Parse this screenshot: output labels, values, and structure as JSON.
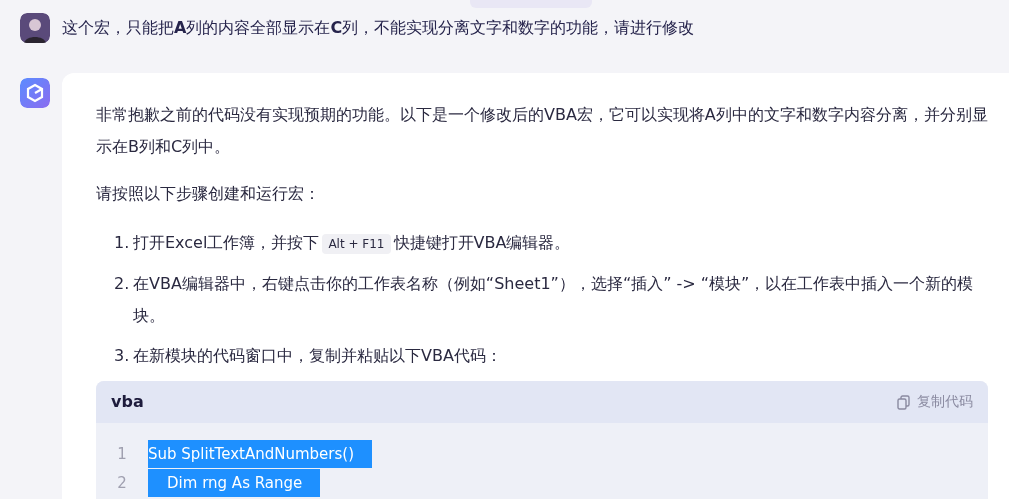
{
  "user_message": {
    "text": "这个宏，只能把**A**列的内容全部显示在**C**列，不能实现分离文字和数字的功能，请进行修改"
  },
  "reply": {
    "paragraphs": [
      "非常抱歉之前的代码没有实现预期的功能。以下是一个修改后的VBA宏，它可以实现将A列中的文字和数字内容分离，并分别显示在B列和C列中。",
      "请按照以下步骤创建和运行宏："
    ],
    "steps": [
      {
        "number": "1.",
        "parts": [
          {
            "kind": "text",
            "text": "打开Excel工作簿，并按下"
          },
          {
            "kind": "key",
            "text": "Alt + F11"
          },
          {
            "kind": "text",
            "text": "快捷键打开VBA编辑器。"
          }
        ]
      },
      {
        "number": "2.",
        "parts": [
          {
            "kind": "text",
            "text": "在VBA编辑器中，右键点击你的工作表名称（例如“Sheet1”），选择“插入” -> “模块”，以在工作表中插入一个新的模块。"
          }
        ]
      },
      {
        "number": "3.",
        "parts": [
          {
            "kind": "text",
            "text": "在新模块的代码窗口中，复制并粘贴以下VBA代码："
          }
        ]
      }
    ],
    "code_block": {
      "language": "vba",
      "copy_label": "复制代码",
      "lines": [
        {
          "number": "1",
          "code": "Sub SplitTextAndNumbers()",
          "selected": true
        },
        {
          "number": "2",
          "code": "    Dim rng As Range",
          "selected": true
        }
      ]
    }
  }
}
